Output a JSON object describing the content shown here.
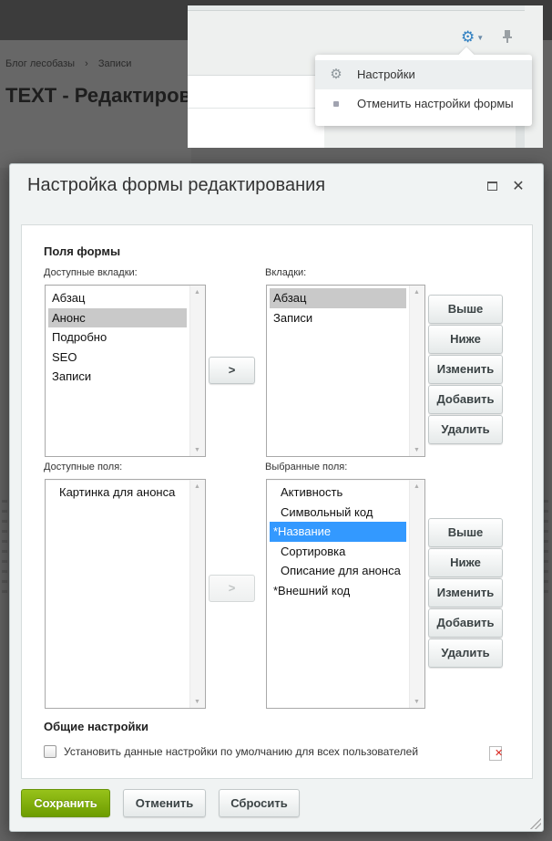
{
  "background": {
    "breadcrumb": [
      "Блог лесобазы",
      "›",
      "Записи"
    ],
    "page_title": "TEXT - Редактиров"
  },
  "settings_menu": {
    "items": [
      {
        "label": "Настройки",
        "icon": "gear-icon"
      },
      {
        "label": "Отменить настройки формы",
        "icon": "square-icon"
      }
    ]
  },
  "dialog": {
    "title": "Настройка формы редактирования",
    "form_fields_title": "Поля формы",
    "available_tabs": {
      "label": "Доступные вкладки:",
      "items": [
        "Абзац",
        "Анонс",
        "Подробно",
        "SEO",
        "Записи"
      ],
      "selected": "Анонс"
    },
    "tabs": {
      "label": "Вкладки:",
      "items": [
        "Абзац",
        "Записи"
      ],
      "selected": "Абзац"
    },
    "move_tab_button": ">",
    "tab_buttons": {
      "up": "Выше",
      "down": "Ниже",
      "edit": "Изменить",
      "add": "Добавить",
      "delete": "Удалить"
    },
    "available_fields": {
      "label": "Доступные поля:",
      "items": [
        "Картинка для анонса"
      ]
    },
    "selected_fields": {
      "label": "Выбранные поля:",
      "items": [
        "Активность",
        "Символьный код",
        "*Название",
        "Сортировка",
        "Описание для анонса",
        "*Внешний код"
      ],
      "selected": "*Название"
    },
    "move_field_button": ">",
    "field_buttons": {
      "up": "Выше",
      "down": "Ниже",
      "edit": "Изменить",
      "add": "Добавить",
      "delete": "Удалить"
    },
    "general_settings_title": "Общие настройки",
    "default_for_all_label": "Установить данные настройки по умолчанию для всех пользователей",
    "default_for_all_checked": false,
    "footer": {
      "save": "Сохранить",
      "cancel": "Отменить",
      "reset": "Сбросить"
    }
  },
  "colors": {
    "save_button": "#7aab08",
    "selection_blue": "#3399ff",
    "selection_grey": "#c9c9c9",
    "accent_icon": "#2f7fc1"
  }
}
